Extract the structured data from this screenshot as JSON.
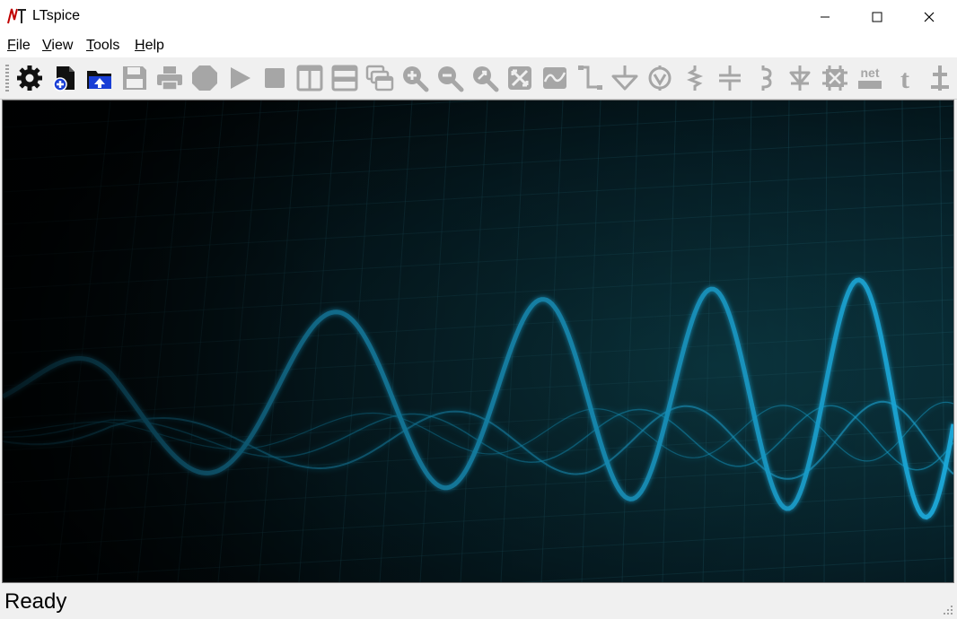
{
  "window": {
    "title": "LTspice",
    "controls": {
      "minimize": "minimize",
      "maximize": "maximize",
      "close": "close"
    }
  },
  "menu": {
    "file": {
      "mnemonic": "F",
      "rest": "ile"
    },
    "view": {
      "mnemonic": "V",
      "rest": "iew"
    },
    "tools": {
      "mnemonic": "T",
      "rest": "ools"
    },
    "help": {
      "mnemonic": "H",
      "rest": "elp"
    }
  },
  "toolbar": {
    "items": [
      {
        "id": "settings",
        "icon": "gear-icon",
        "enabled": true
      },
      {
        "id": "new-schematic",
        "icon": "new-schematic-icon",
        "enabled": true
      },
      {
        "id": "open",
        "icon": "open-folder-icon",
        "enabled": true
      },
      {
        "id": "save",
        "icon": "save-icon",
        "enabled": false
      },
      {
        "id": "print",
        "icon": "print-icon",
        "enabled": false
      },
      {
        "id": "halt",
        "icon": "stop-sign-icon",
        "enabled": false
      },
      {
        "id": "run",
        "icon": "run-icon",
        "enabled": false
      },
      {
        "id": "stop",
        "icon": "stop-icon",
        "enabled": false
      },
      {
        "id": "tile-vertical",
        "icon": "tile-vertical-icon",
        "enabled": false
      },
      {
        "id": "tile-horizontal",
        "icon": "tile-horizontal-icon",
        "enabled": false
      },
      {
        "id": "cascade",
        "icon": "cascade-icon",
        "enabled": false
      },
      {
        "id": "zoom-in",
        "icon": "zoom-in-icon",
        "enabled": false
      },
      {
        "id": "zoom-out",
        "icon": "zoom-out-icon",
        "enabled": false
      },
      {
        "id": "zoom-fit",
        "icon": "zoom-fit-icon",
        "enabled": false
      },
      {
        "id": "zoom-full",
        "icon": "zoom-full-icon",
        "enabled": false
      },
      {
        "id": "autorange",
        "icon": "waveform-icon",
        "enabled": false
      },
      {
        "id": "draw-wire",
        "icon": "wire-icon",
        "enabled": false
      },
      {
        "id": "ground",
        "icon": "ground-icon",
        "enabled": false
      },
      {
        "id": "label-net",
        "icon": "net-label-icon",
        "enabled": false
      },
      {
        "id": "resistor",
        "icon": "resistor-icon",
        "enabled": false
      },
      {
        "id": "capacitor",
        "icon": "capacitor-icon",
        "enabled": false
      },
      {
        "id": "inductor",
        "icon": "inductor-icon",
        "enabled": false
      },
      {
        "id": "diode",
        "icon": "diode-icon",
        "enabled": false
      },
      {
        "id": "component",
        "icon": "component-icon",
        "enabled": false
      },
      {
        "id": "spice-directive",
        "icon": "spice-directive-icon",
        "enabled": false,
        "text": "net"
      },
      {
        "id": "text",
        "icon": "text-icon",
        "enabled": false,
        "text": "t"
      },
      {
        "id": "move",
        "icon": "move-icon",
        "enabled": false
      }
    ]
  },
  "canvas": {
    "description_free": true,
    "background": "#020a0c",
    "wave_color": "#1ba8d8"
  },
  "status": {
    "text": "Ready"
  }
}
